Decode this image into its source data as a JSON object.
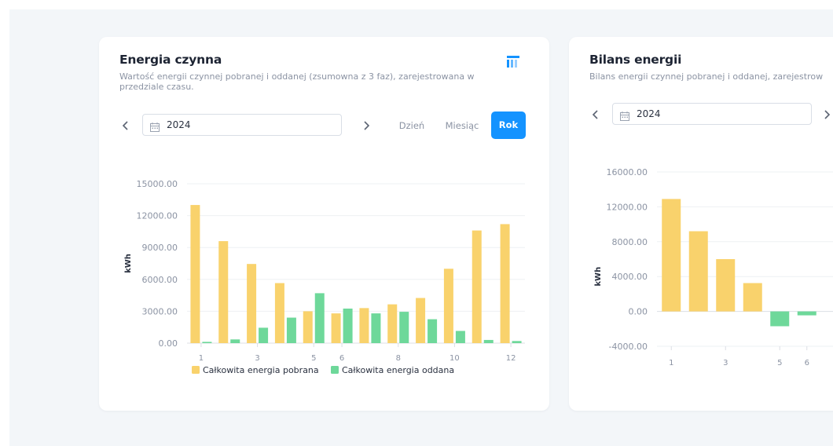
{
  "card1": {
    "title": "Energia czynna",
    "subtitle": "Wartość energii czynnej pobranej i oddanej (zsumowna z 3 faz), zarejestrowana w przedziale czasu.",
    "date_value": "2024",
    "segments": [
      "Dzień",
      "Miesiąc",
      "Rok"
    ],
    "active_segment": "Rok"
  },
  "card2": {
    "title": "Bilans energii",
    "subtitle": "Bilans energii czynnej pobranej i oddanej, zarejestrow",
    "date_value": "2024"
  },
  "colors": {
    "accent": "#1493ff",
    "pobrana": "#f9d26c",
    "oddana": "#6ed89a"
  },
  "chart_data": [
    {
      "type": "bar",
      "categories": [
        "1",
        "2",
        "3",
        "4",
        "5",
        "6",
        "7",
        "8",
        "9",
        "10",
        "11",
        "12"
      ],
      "x_tick_labels": [
        "1",
        "3",
        "5",
        "6",
        "8",
        "10",
        "12"
      ],
      "ylabel": "kWh",
      "y_tick_labels": [
        "0.00",
        "3000.00",
        "6000.00",
        "9000.00",
        "12000.00",
        "15000.00"
      ],
      "ylim": [
        0,
        15000
      ],
      "series": [
        {
          "name": "Całkowita energia pobrana",
          "color": "#f9d26c",
          "values": [
            13000,
            9600,
            7450,
            5650,
            3000,
            2800,
            3300,
            3650,
            4250,
            7000,
            10600,
            11200
          ]
        },
        {
          "name": "Całkowita energia oddana",
          "color": "#6ed89a",
          "values": [
            120,
            350,
            1450,
            2400,
            4700,
            3250,
            2800,
            2950,
            2250,
            1150,
            300,
            200
          ]
        }
      ],
      "legend": "bottom",
      "grid": true
    },
    {
      "type": "bar",
      "categories": [
        "1",
        "2",
        "3",
        "4",
        "5",
        "6"
      ],
      "x_tick_labels": [
        "1",
        "3",
        "5",
        "6"
      ],
      "ylabel": "kWh",
      "y_tick_labels": [
        "-4000.00",
        "0.00",
        "4000.00",
        "8000.00",
        "12000.00",
        "16000.00"
      ],
      "ylim": [
        -4000,
        16000
      ],
      "series": [
        {
          "color": "#f9d26c",
          "values": [
            12900,
            9200,
            6000,
            3250,
            -1700,
            -450
          ]
        }
      ],
      "grid": true
    }
  ]
}
